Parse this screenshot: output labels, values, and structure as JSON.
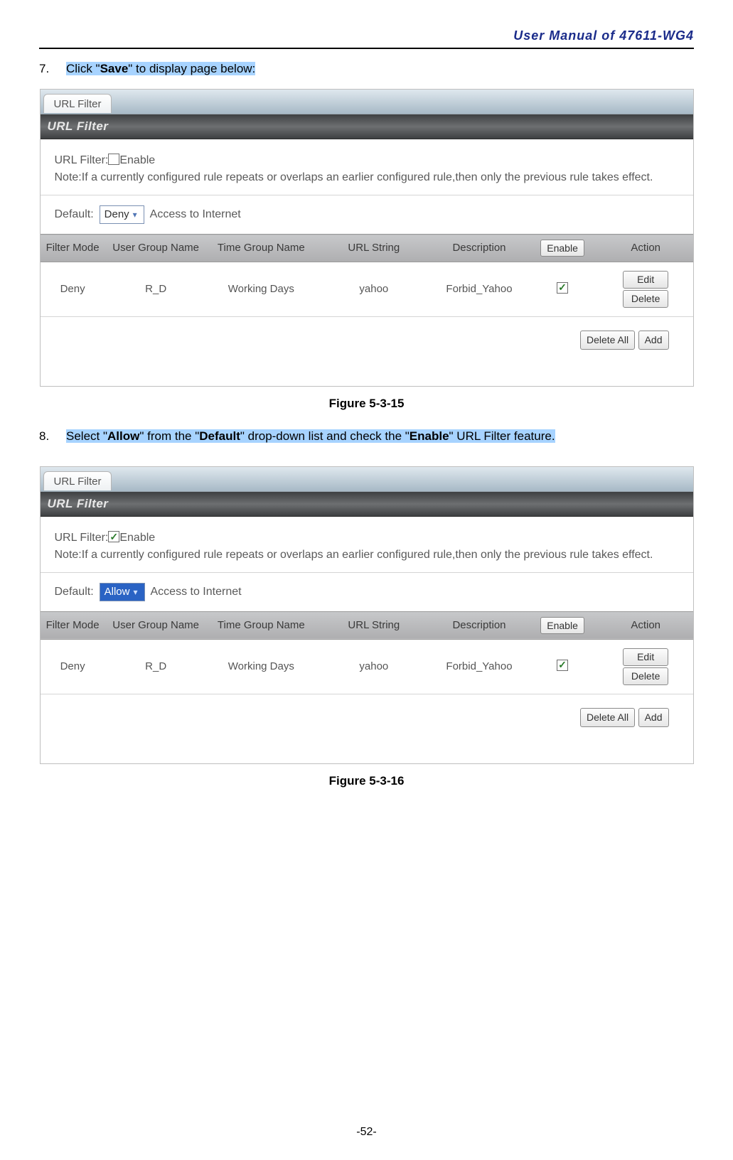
{
  "doc_header": "User Manual of 47611-WG4",
  "step7": {
    "num": "7.",
    "pre": "Click \"",
    "bold": "Save",
    "post": "\" to display page below:"
  },
  "step8": {
    "num": "8.",
    "p1": "Select \"",
    "b1": "Allow",
    "p2": "\" from the \"",
    "b2": "Default",
    "p3": "\" drop-down list and check the \"",
    "b3": "Enable",
    "p4": "\" URL Filter feature."
  },
  "fig_a": "Figure 5-3-15",
  "fig_b": "Figure 5-3-16",
  "shot1": {
    "tab": "URL Filter",
    "title": "URL Filter",
    "url_filter_label_pre": "URL Filter:",
    "url_filter_label_post": "Enable",
    "enable_checked": false,
    "note": "Note:If a currently configured rule repeats or overlaps an earlier configured rule,then only the previous rule takes effect.",
    "default_label": "Default:",
    "default_value": "Deny",
    "default_selected_styled": false,
    "default_suffix": "Access to Internet",
    "headers": [
      "Filter Mode",
      "User Group Name",
      "Time Group Name",
      "URL String",
      "Description",
      "Enable",
      "Action"
    ],
    "row": {
      "mode": "Deny",
      "ug": "R_D",
      "tg": "Working Days",
      "url": "yahoo",
      "desc": "Forbid_Yahoo",
      "en_checked": true,
      "edit": "Edit",
      "del": "Delete"
    },
    "delete_all": "Delete All",
    "add": "Add"
  },
  "shot2": {
    "tab": "URL Filter",
    "title": "URL Filter",
    "url_filter_label_pre": "URL Filter:",
    "url_filter_label_post": "Enable",
    "enable_checked": true,
    "note": "Note:If a currently configured rule repeats or overlaps an earlier configured rule,then only the previous rule takes effect.",
    "default_label": "Default:",
    "default_value": "Allow",
    "default_selected_styled": true,
    "default_suffix": "Access to Internet",
    "headers": [
      "Filter Mode",
      "User Group Name",
      "Time Group Name",
      "URL String",
      "Description",
      "Enable",
      "Action"
    ],
    "row": {
      "mode": "Deny",
      "ug": "R_D",
      "tg": "Working Days",
      "url": "yahoo",
      "desc": "Forbid_Yahoo",
      "en_checked": true,
      "edit": "Edit",
      "del": "Delete"
    },
    "delete_all": "Delete All",
    "add": "Add"
  },
  "page_footer": "-52-"
}
